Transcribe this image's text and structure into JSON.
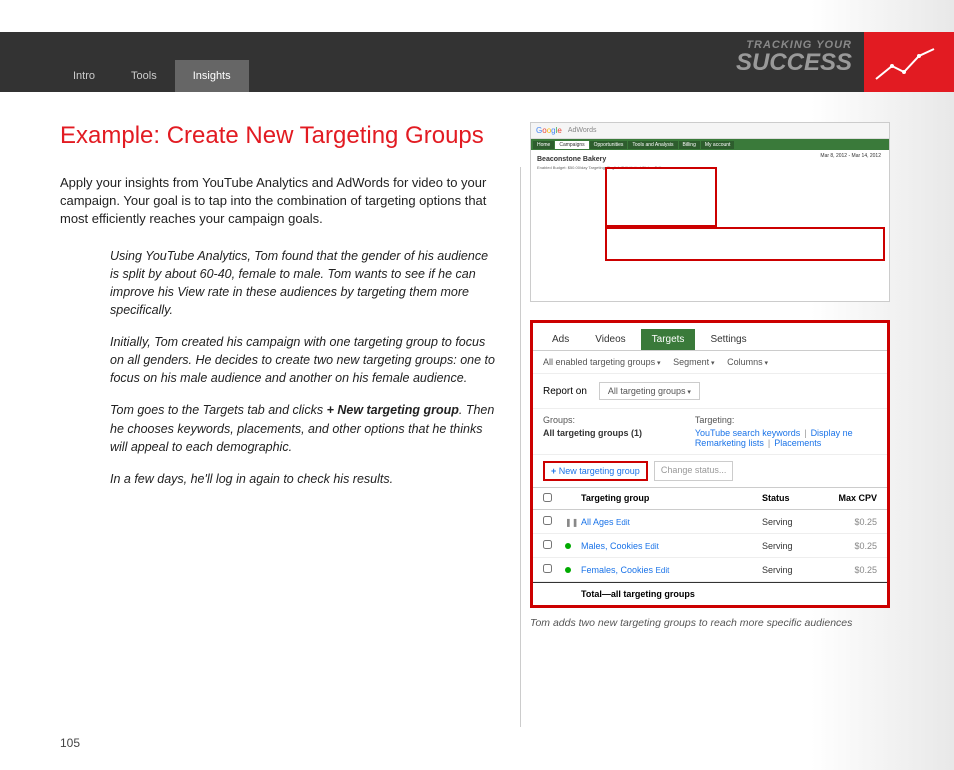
{
  "header": {
    "tabs": [
      "Intro",
      "Tools",
      "Insights"
    ],
    "active_tab": 2,
    "tracking_small": "TRACKING YOUR",
    "tracking_big": "SUCCESS"
  },
  "page_number": "105",
  "title": "Example: Create New Targeting Groups",
  "intro": "Apply your insights from YouTube Analytics and AdWords for video to your campaign. Your goal is to tap into the combination of targeting options that most efficiently reaches your campaign goals.",
  "story": {
    "p1": "Using YouTube Analytics, Tom found that the gender of his audience is split by about 60-40, female to male. Tom wants to see if he can improve his View rate in these audiences by targeting them more specifically.",
    "p2": "Initially, Tom created his campaign with one targeting group to focus on all genders. He decides to create two new targeting groups: one to focus on his male audience and another on his female audience.",
    "p3a": "Tom goes to the Targets tab and clicks ",
    "p3b": "+ New targeting group",
    "p3c": ". Then he chooses keywords, placements, and other options that he thinks will appeal to each demographic.",
    "p4": "In a few days, he'll log in again to check his results."
  },
  "shot1": {
    "logo_suffix": "AdWords",
    "nav": [
      "Home",
      "Campaigns",
      "Opportunities",
      "Tools and Analysis",
      "Billing",
      "My account"
    ],
    "campaign_name": "Beaconstone Bakery",
    "date_range": "Mar 8, 2012 - Mar 14, 2012",
    "status_line": "Enabled   Budget: $50.00/day   Targeting: English  Edit   United States  Edit"
  },
  "shot2": {
    "tabs": [
      "Ads",
      "Videos",
      "Targets",
      "Settings"
    ],
    "active_tab": 2,
    "filters": [
      "All enabled targeting groups",
      "Segment",
      "Columns"
    ],
    "report_label": "Report on",
    "report_btn": "All targeting groups",
    "groups_label": "Groups:",
    "groups_value": "All targeting groups (1)",
    "targeting_label": "Targeting:",
    "targeting_links": [
      "YouTube search keywords",
      "Display ne",
      "Remarketing lists",
      "Placements"
    ],
    "new_tg_btn": "New targeting group",
    "change_status": "Change status...",
    "columns": [
      "Targeting group",
      "Status",
      "Max CPV"
    ],
    "rows": [
      {
        "status": "paused",
        "name": "All Ages",
        "serving": "Serving",
        "cpv": "$0.25"
      },
      {
        "status": "active",
        "name": "Males, Cookies",
        "serving": "Serving",
        "cpv": "$0.25"
      },
      {
        "status": "active",
        "name": "Females, Cookies",
        "serving": "Serving",
        "cpv": "$0.25"
      }
    ],
    "total_label": "Total—all targeting groups"
  },
  "caption": "Tom adds two new targeting groups to reach more specific audiences"
}
